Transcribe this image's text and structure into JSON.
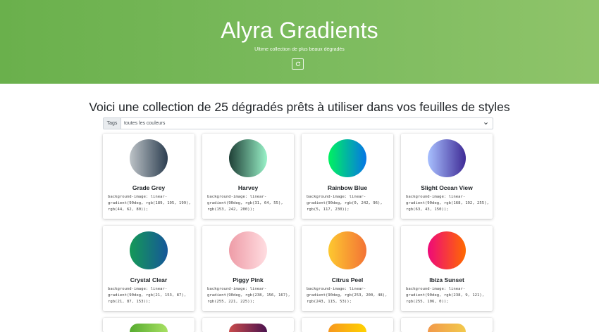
{
  "hero": {
    "title": "Alyra Gradients",
    "subtitle": "Ultime collection de plus beaux dégradés",
    "reload_icon": "reload-icon"
  },
  "section": {
    "title": "Voici une collection de 25 dégradés prêts à utiliser dans vos feuilles de styles"
  },
  "filter": {
    "label": "Tags",
    "selected": "toutes les couleurs"
  },
  "cards": [
    {
      "name": "Grade Grey",
      "code": "background-image: linear-gradient(90deg, rgb(189, 195, 199), rgb(44, 62, 80));",
      "from": "#bdc3c7",
      "to": "#2c3e50"
    },
    {
      "name": "Harvey",
      "code": "background-image: linear-gradient(90deg, rgb(31, 64, 55), rgb(153, 242, 200));",
      "from": "#1f4037",
      "to": "#99f2c8"
    },
    {
      "name": "Rainbow Blue",
      "code": "background-image: linear-gradient(90deg, rgb(0, 242, 96), rgb(5, 117, 230));",
      "from": "#00f260",
      "to": "#0575e6"
    },
    {
      "name": "Slight Ocean View",
      "code": "background-image: linear-gradient(90deg, rgb(168, 192, 255), rgb(63, 43, 150));",
      "from": "#a8c0ff",
      "to": "#3f2b96"
    },
    {
      "name": "Crystal Clear",
      "code": "background-image: linear-gradient(90deg, rgb(21, 153, 87), rgb(21, 87, 153));",
      "from": "#159957",
      "to": "#155799"
    },
    {
      "name": "Piggy Pink",
      "code": "background-image: linear-gradient(90deg, rgb(238, 156, 167), rgb(255, 221, 225));",
      "from": "#ee9ca7",
      "to": "#ffdde1"
    },
    {
      "name": "Citrus Peel",
      "code": "background-image: linear-gradient(90deg, rgb(253, 200, 48), rgb(243, 115, 53));",
      "from": "#fdc830",
      "to": "#f37335"
    },
    {
      "name": "Ibiza Sunset",
      "code": "background-image: linear-gradient(90deg, rgb(238, 9, 121), rgb(255, 106, 0));",
      "from": "#ee0979",
      "to": "#ff6a00"
    }
  ],
  "partial_cards": [
    {
      "from": "#56ab2f",
      "to": "#a8e063"
    },
    {
      "from": "#c94b4b",
      "to": "#4b134f"
    },
    {
      "from": "#f7971e",
      "to": "#ffd200"
    },
    {
      "from": "#f2994a",
      "to": "#f2c94c"
    }
  ],
  "colors": {
    "hero_gradient_start": "#6ab04c",
    "hero_gradient_end": "#8fc46a"
  }
}
